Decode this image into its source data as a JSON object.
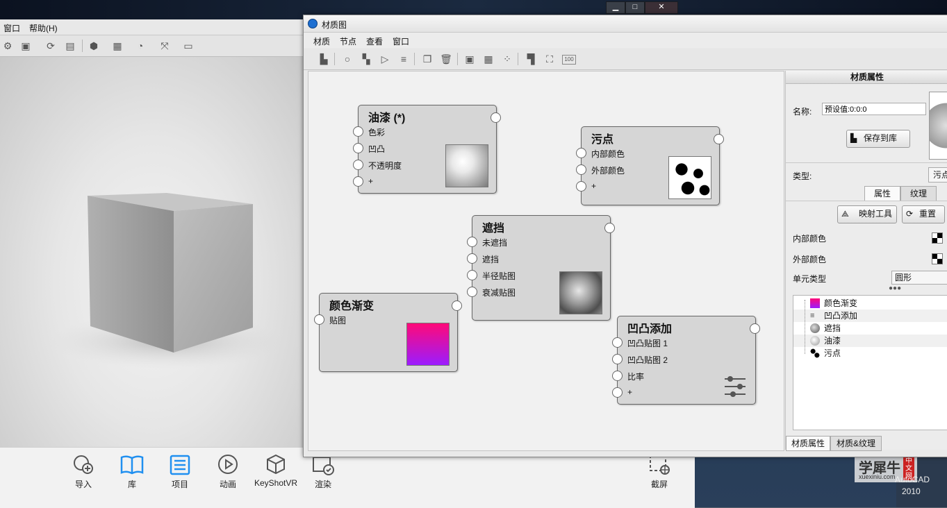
{
  "desktop": {
    "watermark": {
      "site_text": "学犀牛",
      "url": "xuexiniu.com",
      "vertical_text": "中文网"
    },
    "brand_text": "AutoCAD",
    "year": "2010"
  },
  "main_window": {
    "menu": [
      "窗口",
      "帮助(H)"
    ],
    "bottom_bar": {
      "buttons": [
        {
          "label": "导入",
          "icon": "import-icon"
        },
        {
          "label": "库",
          "icon": "library-icon"
        },
        {
          "label": "项目",
          "icon": "project-icon"
        },
        {
          "label": "动画",
          "icon": "animation-icon"
        },
        {
          "label": "KeyShotVR",
          "icon": "keyshotvr-icon"
        },
        {
          "label": "渲染",
          "icon": "render-icon"
        },
        {
          "label": "截屏",
          "icon": "screenshot-icon"
        }
      ]
    }
  },
  "material_graph": {
    "title": "材质图",
    "menu": [
      "材质",
      "节点",
      "查看",
      "窗口"
    ],
    "nodes": {
      "paint": {
        "title": "油漆 (*)",
        "inputs": [
          "色彩",
          "凹凸",
          "不透明度",
          "+"
        ]
      },
      "spots": {
        "title": "污点",
        "inputs": [
          "内部颜色",
          "外部颜色",
          "+"
        ]
      },
      "occlusion": {
        "title": "遮挡",
        "inputs": [
          "未遮挡",
          "遮挡",
          "半径贴图",
          "衰减贴图"
        ]
      },
      "gradient": {
        "title": "颜色渐变",
        "inputs": [
          "贴图"
        ],
        "colors": [
          "#ff0a78",
          "#9b1cff"
        ]
      },
      "bump_add": {
        "title": "凹凸添加",
        "inputs": [
          "凹凸贴图 1",
          "凹凸贴图 2",
          "比率",
          "+"
        ]
      }
    }
  },
  "properties_panel": {
    "header": "材质属性",
    "name_label": "名称:",
    "name_value": "预设值:0:0:0",
    "save_button": "保存到库",
    "type_label": "类型:",
    "type_value": "污点",
    "tabs": [
      "属性",
      "纹理"
    ],
    "mapping_button": "映射工具",
    "reset_button": "重置",
    "inner_color_label": "内部颜色",
    "outer_color_label": "外部颜色",
    "cell_type_label": "单元类型",
    "cell_type_value": "圆形",
    "tree_items": [
      "颜色渐变",
      "凹凸添加",
      "遮挡",
      "油漆",
      "污点"
    ],
    "bottom_tabs": [
      "材质属性",
      "材质&纹理"
    ]
  }
}
